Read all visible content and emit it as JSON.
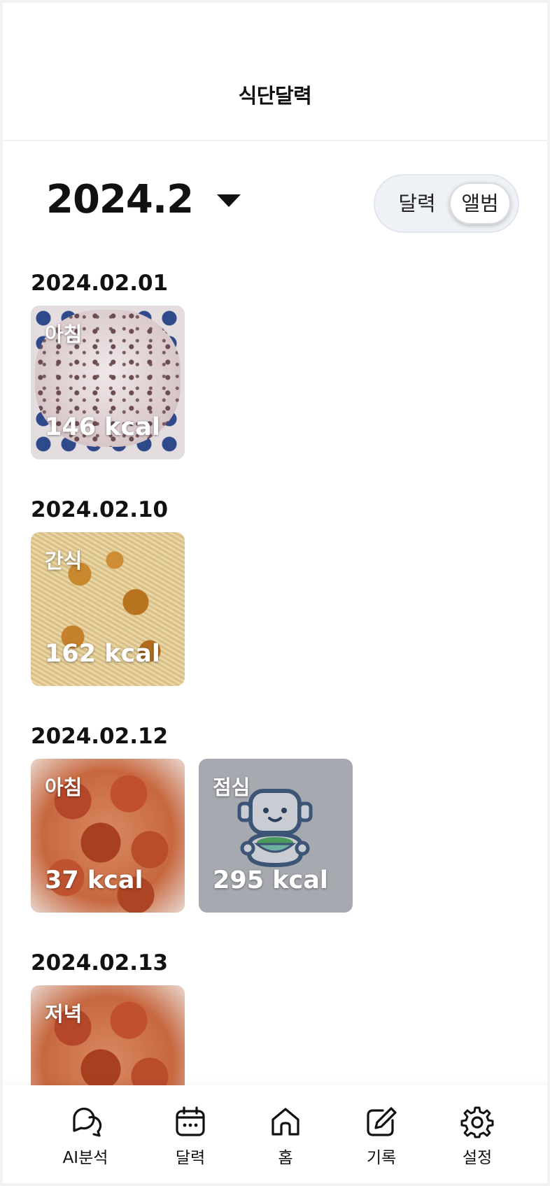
{
  "header": {
    "title": "식단달력"
  },
  "month_picker": {
    "value": "2024.2",
    "icon": "caret-down-icon"
  },
  "view_toggle": {
    "options": [
      "달력",
      "앨범"
    ],
    "selected": "앨범"
  },
  "days": [
    {
      "date": "2024.02.01",
      "meals": [
        {
          "label": "아침",
          "kcal": "146 kcal"
        }
      ]
    },
    {
      "date": "2024.02.10",
      "meals": [
        {
          "label": "간식",
          "kcal": "162 kcal"
        }
      ]
    },
    {
      "date": "2024.02.12",
      "meals": [
        {
          "label": "아침",
          "kcal": "37 kcal"
        },
        {
          "label": "점심",
          "kcal": "295 kcal"
        }
      ]
    },
    {
      "date": "2024.02.13",
      "meals": [
        {
          "label": "저녁",
          "kcal": ""
        }
      ]
    }
  ],
  "bottom_nav": [
    {
      "label": "AI분석",
      "icon": "chat-bubbles-icon"
    },
    {
      "label": "달력",
      "icon": "calendar-icon"
    },
    {
      "label": "홈",
      "icon": "home-icon"
    },
    {
      "label": "기록",
      "icon": "edit-icon"
    },
    {
      "label": "설정",
      "icon": "gear-icon"
    }
  ],
  "colors": {
    "placeholder_tile": "#a6a9af",
    "toggle_bg": "#eef1f5",
    "text": "#111111"
  }
}
